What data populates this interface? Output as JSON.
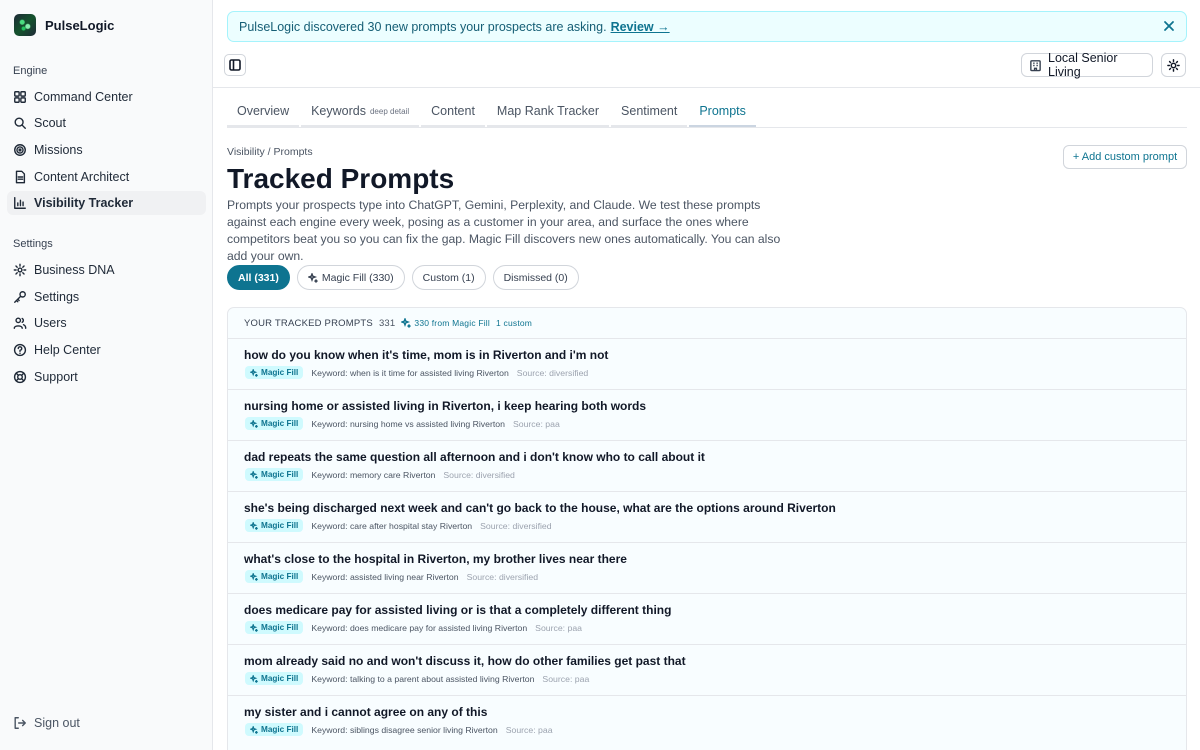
{
  "app": {
    "name": "PulseLogic"
  },
  "sidebar": {
    "sections": [
      {
        "title": "Engine"
      },
      {
        "title": "Settings"
      }
    ],
    "engine_items": [
      {
        "label": "Command Center",
        "icon": "grid-icon"
      },
      {
        "label": "Scout",
        "icon": "search-icon"
      },
      {
        "label": "Missions",
        "icon": "target-icon"
      },
      {
        "label": "Content Architect",
        "icon": "document-icon"
      },
      {
        "label": "Visibility Tracker",
        "icon": "bar-chart-icon",
        "active": true
      }
    ],
    "settings_items": [
      {
        "label": "Business DNA",
        "icon": "gear-icon"
      },
      {
        "label": "Settings",
        "icon": "key-icon"
      },
      {
        "label": "Users",
        "icon": "users-icon"
      },
      {
        "label": "Help Center",
        "icon": "help-icon"
      },
      {
        "label": "Support",
        "icon": "lifebuoy-icon"
      }
    ],
    "signout": "Sign out"
  },
  "banner": {
    "text": "PulseLogic discovered 30 new prompts your prospects are asking.",
    "link": "Review →"
  },
  "header": {
    "location": "Local Senior Living"
  },
  "tabs": [
    {
      "label": "Overview"
    },
    {
      "label": "Keywords",
      "sub": "deep detail"
    },
    {
      "label": "Content"
    },
    {
      "label": "Map Rank Tracker"
    },
    {
      "label": "Sentiment"
    },
    {
      "label": "Prompts",
      "active": true
    }
  ],
  "page": {
    "breadcrumb": "Visibility / Prompts",
    "title": "Tracked Prompts",
    "description": "Prompts your prospects type into ChatGPT, Gemini, Perplexity, and Claude. We test these prompts against each engine every week, posing as a customer in your area, and surface the ones where competitors beat you so you can fix the gap. Magic Fill discovers new ones automatically. You can also add your own.",
    "add_button": "+ Add custom prompt"
  },
  "filters": [
    {
      "label": "All (331)",
      "active": true
    },
    {
      "label": "Magic Fill (330)",
      "icon": "sparkle-icon"
    },
    {
      "label": "Custom (1)"
    },
    {
      "label": "Dismissed (0)"
    }
  ],
  "list": {
    "header": "YOUR TRACKED PROMPTS",
    "count": "331",
    "magic_fill": "330 from Magic Fill",
    "custom": "1 custom",
    "badge_label": "Magic Fill",
    "rows": [
      {
        "title": "how do you know when it's time, mom is in Riverton and i'm not",
        "keyword": "Keyword: when is it time for assisted living Riverton",
        "source": "Source: diversified"
      },
      {
        "title": "nursing home or assisted living in Riverton, i keep hearing both words",
        "keyword": "Keyword: nursing home vs assisted living Riverton",
        "source": "Source: paa"
      },
      {
        "title": "dad repeats the same question all afternoon and i don't know who to call about it",
        "keyword": "Keyword: memory care Riverton",
        "source": "Source: diversified"
      },
      {
        "title": "she's being discharged next week and can't go back to the house, what are the options around Riverton",
        "keyword": "Keyword: care after hospital stay Riverton",
        "source": "Source: diversified"
      },
      {
        "title": "what's close to the hospital in Riverton, my brother lives near there",
        "keyword": "Keyword: assisted living near Riverton",
        "source": "Source: diversified"
      },
      {
        "title": "does medicare pay for assisted living or is that a completely different thing",
        "keyword": "Keyword: does medicare pay for assisted living Riverton",
        "source": "Source: paa"
      },
      {
        "title": "mom already said no and won't discuss it, how do other families get past that",
        "keyword": "Keyword: talking to a parent about assisted living Riverton",
        "source": "Source: paa"
      },
      {
        "title": "my sister and i cannot agree on any of this",
        "keyword": "Keyword: siblings disagree senior living Riverton",
        "source": "Source: paa"
      }
    ]
  },
  "colors": {
    "accent": "#0e7490",
    "banner_bg": "#ecfeff",
    "badge_bg": "#cffafe"
  }
}
